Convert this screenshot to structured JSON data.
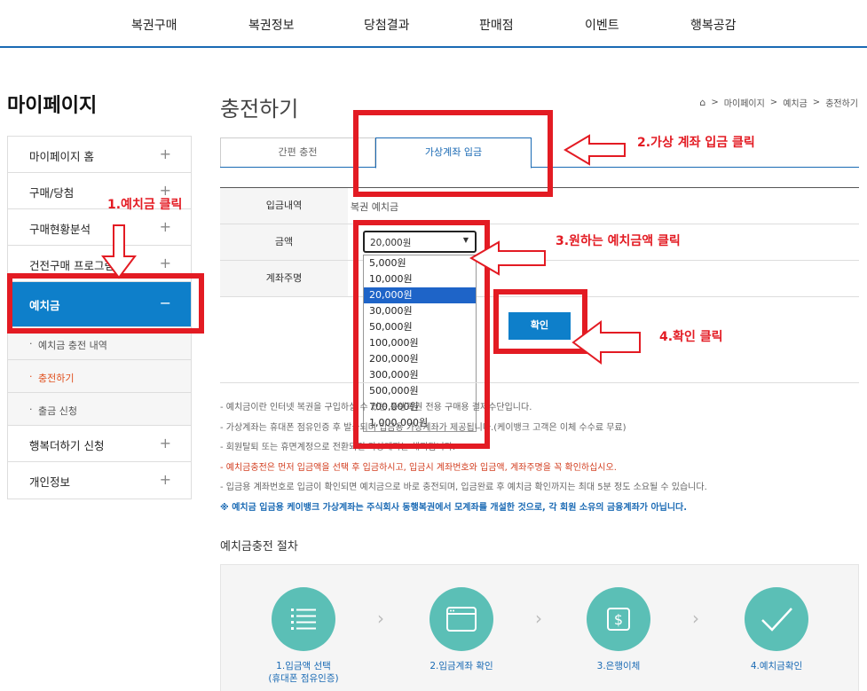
{
  "nav": [
    "복권구매",
    "복권정보",
    "당첨결과",
    "판매점",
    "이벤트",
    "행복공감"
  ],
  "sidebar": {
    "title": "마이페이지",
    "items": [
      {
        "label": "마이페이지 홈",
        "toggle": "+"
      },
      {
        "label": "구매/당첨",
        "toggle": "+"
      },
      {
        "label": "구매현황분석",
        "toggle": "+"
      },
      {
        "label": "건전구매 프로그램",
        "toggle": "+"
      },
      {
        "label": "예치금",
        "toggle": "−"
      }
    ],
    "subitems": [
      {
        "label": "예치금 충전 내역"
      },
      {
        "label": "충전하기"
      },
      {
        "label": "출금 신청"
      }
    ],
    "items_after": [
      {
        "label": "행복더하기 신청",
        "toggle": "+"
      },
      {
        "label": "개인정보",
        "toggle": "+"
      }
    ]
  },
  "main": {
    "title": "충전하기",
    "breadcrumb": [
      "마이페이지",
      "예치금",
      "충전하기"
    ],
    "tabs": [
      "간편 충전",
      "가상계좌 입금"
    ],
    "form": {
      "deposit_label": "입금내역",
      "deposit_value": "복권 예치금",
      "amount_label": "금액",
      "amount_selected": "20,000원",
      "account_label": "계좌주명"
    },
    "amount_options": [
      "5,000원",
      "10,000원",
      "20,000원",
      "30,000원",
      "50,000원",
      "100,000원",
      "200,000원",
      "300,000원",
      "500,000원",
      "700,000원",
      "1,000,000원"
    ],
    "confirm_label": "확인",
    "notes": [
      "-  예치금이란 인터넷 복권을 구입하실 수 있는 동행복권 전용 구매용 결제수단입니다.",
      "-  가상계좌는 휴대폰 점유인증 후 발급되며 입금용 가상계좌가 제공됩니다.(케이뱅크 고객은 이체 수수료 무료)",
      "-  회원탈퇴 또는 휴면계정으로 전환되면 가상계좌는 해지됩니다.",
      "-  예치금충전은 먼저 입금액을 선택 후 입금하시고, 입금시 계좌번호와 입금액, 계좌주명을 꼭 확인하십시오.",
      "-  입금용 계좌번호로 입금이 확인되면 예치금으로 바로 충전되며, 입금완료 후 예치금 확인까지는 최대 5분 정도 소요될 수 있습니다.",
      "※ 예치금 입금용 케이뱅크 가상계좌는 주식회사 동행복권에서 모계좌를 개설한 것으로, 각 회원 소유의 금융계좌가 아닙니다."
    ],
    "procedure_title": "예치금충전 절차",
    "steps": [
      {
        "label": "1.입금액 선택",
        "sub": "(휴대폰 점유인증)"
      },
      {
        "label": "2.입금계좌 확인",
        "sub": ""
      },
      {
        "label": "3.은행이체",
        "sub": ""
      },
      {
        "label": "4.예치금확인",
        "sub": ""
      }
    ]
  },
  "annotations": {
    "a1": "1.예치금 클릭",
    "a2": "2.가상 계좌 입금 클릭",
    "a3": "3.원하는 예치금액 클릭",
    "a4": "4.확인 클릭"
  },
  "colors": {
    "accent": "#0e7fca",
    "annotation": "#e31b23",
    "step_circle": "#5bbfb6"
  }
}
